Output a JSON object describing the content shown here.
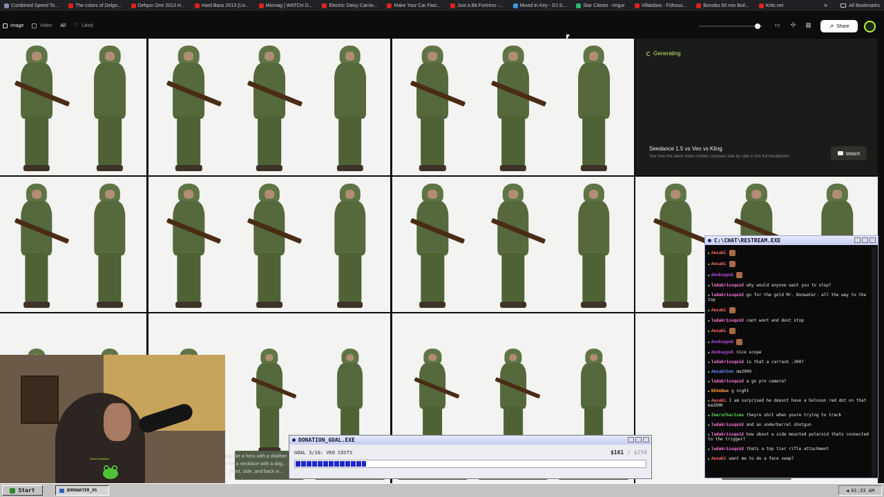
{
  "bookmarks": {
    "items": [
      {
        "label": "Combined Speed To...",
        "icon": "globe-icon",
        "color": "#8a8ab0"
      },
      {
        "label": "The colors of Delgo...",
        "icon": "youtube-icon",
        "color": "#e02020"
      },
      {
        "label": "Defqon One 2013 H...",
        "icon": "youtube-icon",
        "color": "#e02020"
      },
      {
        "label": "Hard Bass 2013 (Liv...",
        "icon": "youtube-icon",
        "color": "#e02020"
      },
      {
        "label": "Mixmag | WATCH D...",
        "icon": "mixmag-icon",
        "color": "#e02020"
      },
      {
        "label": "Electric Daisy Carniv...",
        "icon": "youtube-icon",
        "color": "#e02020"
      },
      {
        "label": "Make Your Car Fast...",
        "icon": "youtube-icon",
        "color": "#e02020"
      },
      {
        "label": "Just a Bit Fortress -...",
        "icon": "youtube-icon",
        "color": "#e02020"
      },
      {
        "label": "Mixed In Key - DJ S...",
        "icon": "link-icon",
        "color": "#3a9ae0"
      },
      {
        "label": "Star Citizen - Imgur",
        "icon": "imgur-icon",
        "color": "#2bb673"
      },
      {
        "label": "Villalobos - Fühouo...",
        "icon": "youtube-icon",
        "color": "#e02020"
      },
      {
        "label": "Bonobo 50 min Boil...",
        "icon": "youtube-icon",
        "color": "#e02020"
      },
      {
        "label": "Kritz.net",
        "icon": "youtube-icon",
        "color": "#e02020"
      }
    ],
    "more": "»",
    "all_bookmarks": "All Bookmarks"
  },
  "toolbar": {
    "filters": [
      {
        "label": "Image",
        "icon": "image-icon",
        "active": true
      },
      {
        "label": "Video",
        "icon": "video-icon",
        "active": false
      },
      {
        "label": "All",
        "icon": "",
        "active": true
      },
      {
        "label": "Liked",
        "icon": "heart-icon",
        "active": false
      }
    ],
    "share_label": "Share",
    "zoom_level": 0.88
  },
  "generating": {
    "status": "Generating",
    "promo_title": "Seedance 1.5 vs Veo vs Kling",
    "promo_subtitle": "See how the latest video models compare side by side in this full breakdown",
    "watch_label": "Watch",
    "accent": "#c7e36b"
  },
  "caption_fragment": {
    "line1": "ing like a hero with a Walther",
    "line2": "n on a necklace with a dog...",
    "line3": "... front, side, and back vi..."
  },
  "chat": {
    "title": "C:\\CHAT\\RESTREAM.EXE",
    "messages": [
      {
        "user": "Aesabi",
        "color": "#ff6a6a",
        "text": "",
        "emote": true
      },
      {
        "user": "Aesabi",
        "color": "#ff6a6a",
        "text": "",
        "emote": true
      },
      {
        "user": "donkeypuk",
        "color": "#b44ce0",
        "text": "",
        "emote": true
      },
      {
        "user": "ludakrissquid",
        "color": "#ff77d9",
        "text": "why would anyone want you to stop?",
        "emote": false
      },
      {
        "user": "ludakrissquid",
        "color": "#ff77d9",
        "text": "go for the gold Mr. Bonwater. all the way to the top",
        "emote": false
      },
      {
        "user": "Aesabi",
        "color": "#ff6a6a",
        "text": "",
        "emote": true
      },
      {
        "user": "ludakrissquid",
        "color": "#ff77d9",
        "text": "cant wont and dont stop",
        "emote": false
      },
      {
        "user": "Aesabi",
        "color": "#ff6a6a",
        "text": "",
        "emote": true
      },
      {
        "user": "donkeypuk",
        "color": "#b44ce0",
        "text": "",
        "emote": true
      },
      {
        "user": "donkeypuk",
        "color": "#b44ce0",
        "text": "nice scope",
        "emote": false
      },
      {
        "user": "ludakrissquid",
        "color": "#ff77d9",
        "text": "is that a carrack .300?",
        "emote": false
      },
      {
        "user": "AesabiGun",
        "color": "#6a8aff",
        "text": "ma2000",
        "emote": false
      },
      {
        "user": "ludakrissquid",
        "color": "#ff77d9",
        "text": "a go pro camera?",
        "emote": false
      },
      {
        "user": "B64eBee",
        "color": "#ff9a3a",
        "text": "g night",
        "emote": false
      },
      {
        "user": "Aesabi",
        "color": "#ff6a6a",
        "text": "I am surprised he doesnt have a holosun red dot on that ma2000",
        "emote": false
      },
      {
        "user": "ZeeroCharisma",
        "color": "#59d459",
        "text": "theyre shit when youre trying to track",
        "emote": false
      },
      {
        "user": "ludakrissquid",
        "color": "#ff77d9",
        "text": "and an underbarrel shotgun",
        "emote": false
      },
      {
        "user": "ludakrissquid",
        "color": "#ff77d9",
        "text": "how about a side mounted polaroid thats connected to the trigger?",
        "emote": false
      },
      {
        "user": "ludakrissquid",
        "color": "#ff77d9",
        "text": "thats a top tier rifle attachment",
        "emote": false
      },
      {
        "user": "Aesabi",
        "color": "#ff6a6a",
        "text": "want me to do a face swap?",
        "emote": false
      }
    ]
  },
  "donation": {
    "title": "DONATION_GOAL.EXE",
    "label": "GOAL 3/10: VEO COSTS",
    "current": "$161",
    "separator": "/",
    "goal": "$250",
    "progress": 0.2
  },
  "taskbar": {
    "start_label": "Start",
    "task_label": "BONGWATER_OS",
    "clock": "01:33 AM"
  },
  "webcam": {
    "badge": "ZeeroCharisma"
  }
}
